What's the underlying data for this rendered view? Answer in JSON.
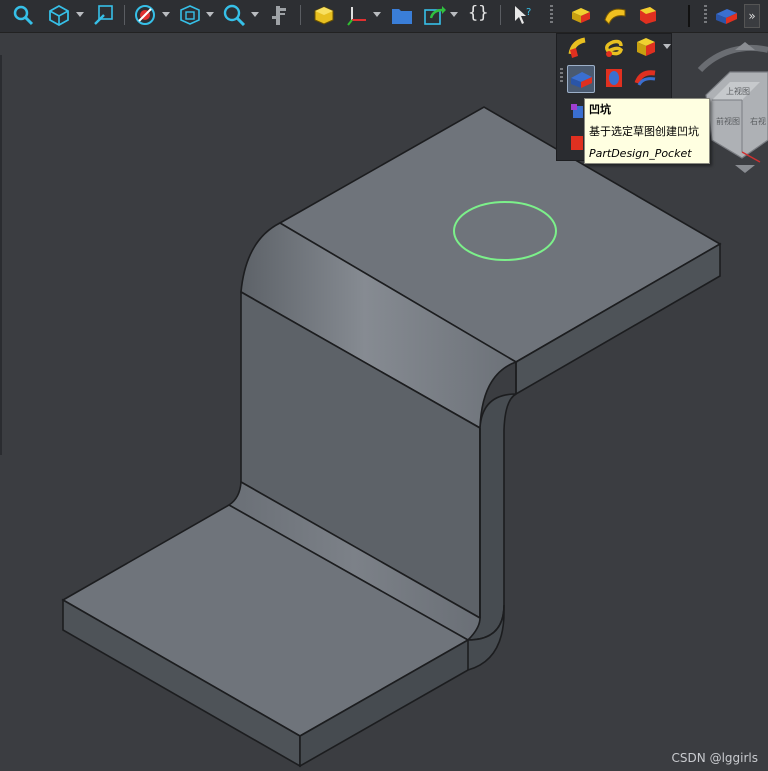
{
  "toolbar": {
    "buttons": [
      {
        "name": "zoom-fit-icon"
      },
      {
        "name": "view-isometric-icon"
      },
      {
        "name": "select-icon"
      },
      {
        "name": "draw-style-icon"
      },
      {
        "name": "bounding-box-icon"
      },
      {
        "name": "zoom-icon"
      },
      {
        "name": "measure-icon"
      },
      {
        "name": "part-icon"
      },
      {
        "name": "axis-icon"
      },
      {
        "name": "folder-icon"
      },
      {
        "name": "link-icon"
      },
      {
        "name": "whats-this-icon"
      },
      {
        "name": "pad-icon"
      },
      {
        "name": "revolution-icon"
      },
      {
        "name": "additive-loft-icon"
      },
      {
        "name": "pocket-icon"
      }
    ],
    "braces_label": "{}",
    "more_label": "»"
  },
  "popup": {
    "rows": [
      [
        "additive-pipe-icon",
        "additive-helix-icon",
        "additive-primitive-icon"
      ],
      [
        "pocket-icon",
        "hole-icon",
        "groove-icon"
      ]
    ],
    "selected": "pocket-icon"
  },
  "tooltip": {
    "title": "凹坑",
    "description": "基于选定草图创建凹坑",
    "command": "PartDesign_Pocket"
  },
  "navcube": {
    "face_top": "上视图",
    "face_front": "前视图",
    "face_right": "右视"
  },
  "colors": {
    "background": "#3b3d41",
    "part_top": "#6f747b",
    "part_side": "#4d5257",
    "sketch_circle": "#7cf08a",
    "tooltip_bg": "#ffffe1"
  },
  "watermark": "CSDN @lggirls"
}
